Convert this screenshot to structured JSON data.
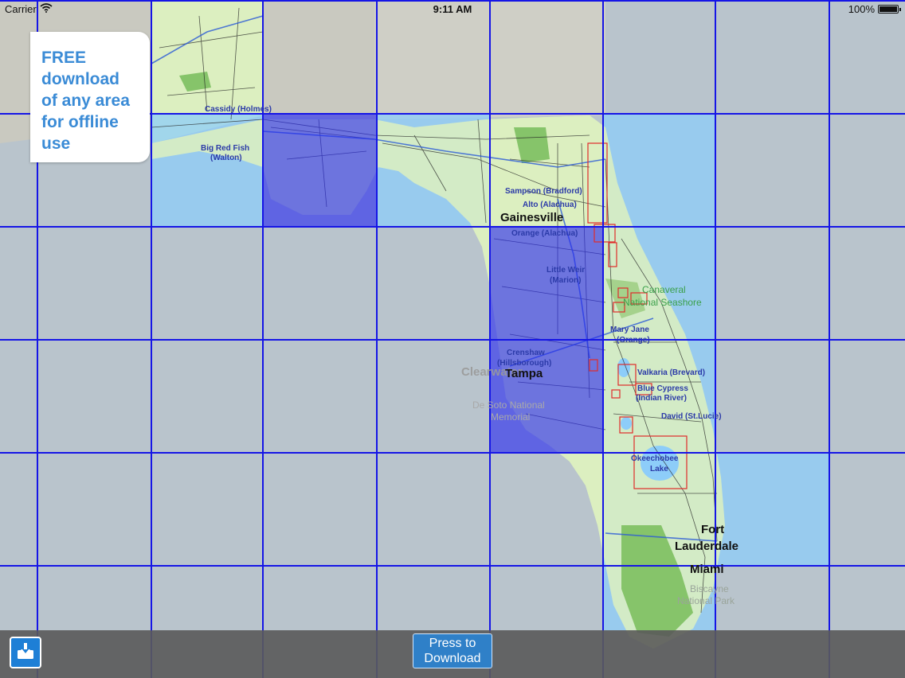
{
  "status_bar": {
    "carrier": "Carrier",
    "time": "9:11 AM",
    "battery": "100%",
    "battery_level": 1.0
  },
  "promo": {
    "text": "FREE\ndownload\nof any area\nfor offline\nuse"
  },
  "toolbar": {
    "press_label": "Press to\nDownload"
  },
  "colors": {
    "grid_line": "#1515e6",
    "selected_tile": "rgba(40,40,240,0.62)",
    "available_tile": "#8dcdf9",
    "land": "#dcefc0",
    "park": "#86c46a",
    "restricted_box": "#e02b2b"
  },
  "map": {
    "city_labels": [
      "Gainesville",
      "Tampa",
      "Fort",
      "Lauderdale",
      "Miami",
      "Clearwater"
    ],
    "place_labels": [
      "Cassidy (Holmes)",
      "Big Red Fish",
      "(Walton)",
      "Sampson (Bradford)",
      "Alto (Alachua)",
      "Orange (Alachua)",
      "Little Weir",
      "(Marion)",
      "Canaveral",
      "National Seashore",
      "Mary Jane",
      "(Orange)",
      "Crenshaw",
      "(Hillsborough)",
      "Valkaria (Brevard)",
      "Blue Cypress",
      "(Indian River)",
      "David (St.Lucie)",
      "Okeechobee",
      "Lake",
      "De Soto National",
      "Memorial",
      "Biscayne",
      "National Park"
    ]
  }
}
